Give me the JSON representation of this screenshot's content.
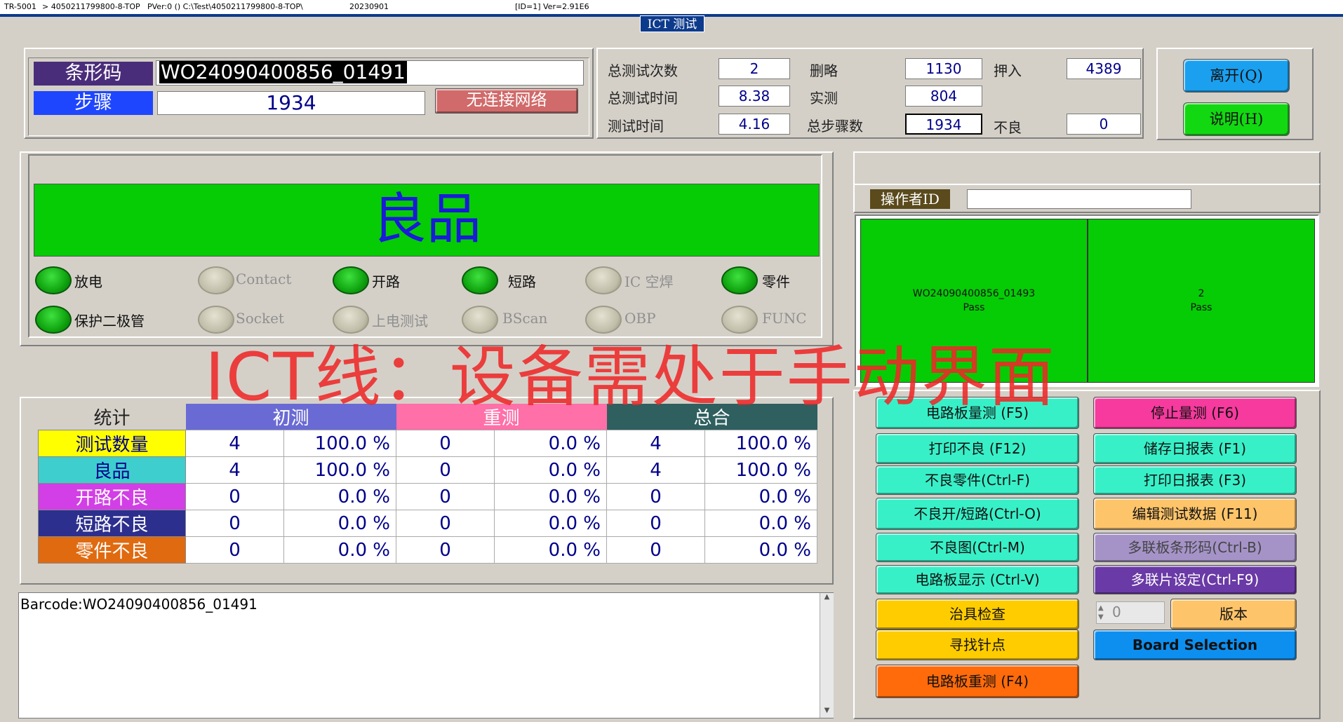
{
  "titlebar": {
    "app": "TR-5001",
    "program": "> 4050211799800-8-TOP",
    "pver": "PVer:0 () C:\\Test\\4050211799800-8-TOP\\",
    "date": "20230901",
    "id_ver": "[ID=1] Ver=2.91E6"
  },
  "window_title": "ICT 测试",
  "barcode": {
    "label": "条形码",
    "value": "WO24090400856_01491"
  },
  "step": {
    "label": "步骤",
    "value": "1934",
    "network_status": "无连接网络"
  },
  "stats": {
    "total_count_label": "总测试次数",
    "total_count": "2",
    "total_time_label": "总测试时间",
    "total_time": "8.38",
    "test_time_label": "测试时间",
    "test_time": "4.16",
    "skip_label": "删略",
    "skip": "1130",
    "measured_label": "实测",
    "measured": "804",
    "total_steps_label": "总步骤数",
    "total_steps": "1934",
    "press_label": "押入",
    "press": "4389",
    "fail_label": "不良",
    "fail": "0"
  },
  "top_buttons": {
    "exit": "离开(Q)",
    "help": "说明(H)"
  },
  "result": {
    "text": "良品",
    "color": "#05cc05"
  },
  "leds": [
    {
      "label": "放电",
      "on": true
    },
    {
      "label": "Contact",
      "on": false
    },
    {
      "label": "开路",
      "on": true
    },
    {
      "label": "短路",
      "on": true
    },
    {
      "label": "IC 空焊",
      "on": false
    },
    {
      "label": "零件",
      "on": true
    },
    {
      "label": "保护二极管",
      "on": true
    },
    {
      "label": "Socket",
      "on": false
    },
    {
      "label": "上电测试",
      "on": false
    },
    {
      "label": "BScan",
      "on": false
    },
    {
      "label": "OBP",
      "on": false
    },
    {
      "label": "FUNC",
      "on": false
    }
  ],
  "watermark": "ICT线：设备需处于手动界面",
  "operator": {
    "label": "操作者ID",
    "value": ""
  },
  "panels": [
    {
      "line1": "WO24090400856_01493",
      "line2": "Pass"
    },
    {
      "line1": "2",
      "line2": "Pass"
    }
  ],
  "table": {
    "corner": "统计",
    "groups": [
      {
        "name": "初测",
        "color": "#6a6ad4"
      },
      {
        "name": "重测",
        "color": "#ff6fa8"
      },
      {
        "name": "总合",
        "color": "#2f5f5f"
      }
    ],
    "rows": [
      {
        "label": "测试数量",
        "bg": "#ffff00",
        "fg": "#00008b",
        "cells": [
          "4",
          "100.0 %",
          "0",
          "0.0 %",
          "4",
          "100.0 %"
        ]
      },
      {
        "label": "良品",
        "bg": "#3ecece",
        "fg": "#00008b",
        "cells": [
          "4",
          "100.0 %",
          "0",
          "0.0 %",
          "4",
          "100.0 %"
        ]
      },
      {
        "label": "开路不良",
        "bg": "#d23fe6",
        "fg": "#ffffff",
        "cells": [
          "0",
          "0.0 %",
          "0",
          "0.0 %",
          "0",
          "0.0 %"
        ]
      },
      {
        "label": "短路不良",
        "bg": "#2d2f8e",
        "fg": "#ffffff",
        "cells": [
          "0",
          "0.0 %",
          "0",
          "0.0 %",
          "0",
          "0.0 %"
        ]
      },
      {
        "label": "零件不良",
        "bg": "#e06a10",
        "fg": "#ffffff",
        "cells": [
          "0",
          "0.0 %",
          "0",
          "0.0 %",
          "0",
          "0.0 %"
        ]
      }
    ]
  },
  "log": {
    "text": "Barcode:WO24090400856_01491"
  },
  "buttons": {
    "board_test": "电路板量测 (F5)",
    "stop_test": "停止量测 (F6)",
    "print_fail": "打印不良 (F12)",
    "save_report": "储存日报表 (F1)",
    "fail_parts": "不良零件(Ctrl-F)",
    "print_report": "打印日报表 (F3)",
    "fail_open_short": "不良开/短路(Ctrl-O)",
    "edit_data": "编辑测试数据 (F11)",
    "fail_map": "不良图(Ctrl-M)",
    "multi_barcode": "多联板条形码(Ctrl-B)",
    "board_display": "电路板显示 (Ctrl-V)",
    "multi_setting": "多联片设定(Ctrl-F9)",
    "fixture_check": "治具检查",
    "spin_value": "0",
    "version": "版本",
    "find_pin": "寻找针点",
    "board_selection": "Board Selection",
    "retest": "电路板重测 (F4)"
  }
}
